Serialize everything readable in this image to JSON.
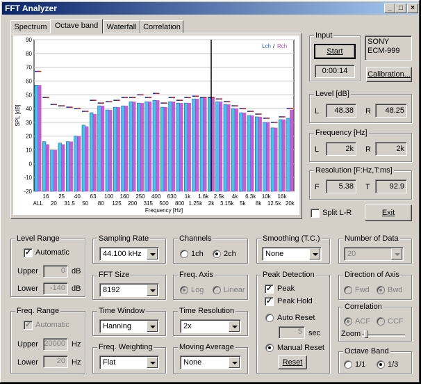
{
  "window": {
    "title": "FFT Analyzer",
    "minimize": "_",
    "maximize": "□",
    "close": "×"
  },
  "tabs": [
    {
      "label": "Spectrum"
    },
    {
      "label": "Octave band"
    },
    {
      "label": "Waterfall"
    },
    {
      "label": "Correlation"
    }
  ],
  "input": {
    "title": "Input",
    "start": "Start",
    "time": "0:00:14",
    "device_line1": "SONY",
    "device_line2": "ECM-999",
    "calibration": "Calibration..."
  },
  "level": {
    "title": "Level [dB]",
    "l_label": "L",
    "l_value": "48.38",
    "r_label": "R",
    "r_value": "48.25"
  },
  "frequency": {
    "title": "Frequency [Hz]",
    "l_label": "L",
    "l_value": "2k",
    "r_label": "R",
    "r_value": "2k"
  },
  "resolution": {
    "title": "Resolution [F:Hz,T:ms]",
    "f_label": "F",
    "f_value": "5.38",
    "t_label": "T",
    "t_value": "92.9"
  },
  "split": {
    "label": "Split L-R"
  },
  "exit": {
    "label": "Exit"
  },
  "level_range": {
    "title": "Level Range",
    "automatic": "Automatic",
    "upper_label": "Upper",
    "upper_value": "0",
    "upper_unit": "dB",
    "lower_label": "Lower",
    "lower_value": "-140",
    "lower_unit": "dB"
  },
  "freq_range": {
    "title": "Freq. Range",
    "automatic": "Automatic",
    "upper_label": "Upper",
    "upper_value": "20000",
    "upper_unit": "Hz",
    "lower_label": "Lower",
    "lower_value": "20",
    "lower_unit": "Hz"
  },
  "sampling_rate": {
    "title": "Sampling Rate",
    "value": "44.100 kHz"
  },
  "fft_size": {
    "title": "FFT Size",
    "value": "8192"
  },
  "time_window": {
    "title": "Time Window",
    "value": "Hanning"
  },
  "freq_weighting": {
    "title": "Freq. Weighting",
    "value": "Flat"
  },
  "channels": {
    "title": "Channels",
    "opt1": "1ch",
    "opt2": "2ch"
  },
  "freq_axis": {
    "title": "Freq. Axis",
    "opt1": "Log",
    "opt2": "Linear"
  },
  "time_resolution": {
    "title": "Time Resolution",
    "value": "2x"
  },
  "moving_average": {
    "title": "Moving Average",
    "value": "None"
  },
  "smoothing": {
    "title": "Smoothing (T.C.)",
    "value": "None"
  },
  "peak_detection": {
    "title": "Peak Detection",
    "peak": "Peak",
    "peak_hold": "Peak Hold",
    "auto_reset": "Auto Reset",
    "sec_value": "5",
    "sec_unit": "sec",
    "manual_reset": "Manual Reset",
    "reset": "Reset"
  },
  "number_of_data": {
    "title": "Number of Data",
    "value": "20"
  },
  "direction_axis": {
    "title": "Direction of Axis",
    "opt1": "Fwd",
    "opt2": "Bwd"
  },
  "correlation": {
    "title": "Correlation",
    "opt1": "ACF",
    "opt2": "CCF",
    "zoom": "Zoom"
  },
  "octave_band": {
    "title": "Octave Band",
    "opt1": "1/1",
    "opt2": "1/3"
  },
  "colors": {
    "lch": "#3ec8f0",
    "rch": "#c040d0",
    "lch_edge": "#1a5aa0",
    "peak_l": "#1030c0",
    "peak_r": "#e01010"
  },
  "chart_data": {
    "type": "bar",
    "ylabel": "SPL [dB]",
    "xlabel": "Frequency [Hz]",
    "ylim": [
      -20,
      90
    ],
    "yticks": [
      -20,
      -10,
      0,
      10,
      20,
      30,
      40,
      50,
      60,
      70,
      80,
      90
    ],
    "legend": {
      "lch": "Lch",
      "rch": "Rch",
      "sep": "/"
    },
    "categories": [
      "ALL",
      "16",
      "20",
      "25",
      "31.5",
      "40",
      "50",
      "63",
      "80",
      "100",
      "125",
      "160",
      "200",
      "250",
      "315",
      "400",
      "500",
      "630",
      "800",
      "1k",
      "1.25k",
      "1.6k",
      "2k",
      "2.5k",
      "3.15k",
      "4k",
      "5k",
      "6.3k",
      "8k",
      "10k",
      "12.5k",
      "16k",
      "20k"
    ],
    "tick_labels_top": [
      "16",
      "25",
      "40",
      "63",
      "100",
      "160",
      "250",
      "400",
      "630",
      "1k",
      "1.6k",
      "2.5k",
      "4k",
      "6.3k",
      "10k",
      "16k"
    ],
    "tick_labels_bottom": [
      "ALL",
      "20",
      "31.5",
      "50",
      "80",
      "125",
      "200",
      "315",
      "500",
      "800",
      "1.25k",
      "2k",
      "3.15k",
      "5k",
      "8k",
      "12.5k",
      "20k"
    ],
    "series": [
      {
        "name": "Lch",
        "values": [
          57,
          16,
          10,
          15,
          16,
          20,
          28,
          37,
          42,
          39,
          41,
          42,
          45,
          44,
          45,
          46,
          41,
          45,
          44,
          44,
          47,
          48,
          48,
          45,
          43,
          40,
          37,
          35,
          34,
          30,
          26,
          32,
          33
        ]
      },
      {
        "name": "Rch",
        "values": [
          57,
          14,
          10,
          14,
          16,
          20,
          27,
          36,
          42,
          39,
          41,
          42,
          45,
          44,
          45,
          46,
          41,
          45,
          44,
          44,
          47,
          48,
          48,
          45,
          43,
          40,
          37,
          35,
          34,
          30,
          26,
          32,
          39
        ]
      }
    ],
    "peak_hold_l": [
      67,
      48,
      43,
      42,
      41,
      40,
      38,
      46,
      44,
      45,
      46,
      48,
      48,
      50,
      48,
      51,
      44,
      48,
      46,
      48,
      49,
      48,
      48,
      47,
      45,
      42,
      40,
      38,
      36,
      33,
      30,
      34,
      40
    ],
    "peak_hold_r": [
      67,
      48,
      43,
      42,
      41,
      40,
      38,
      46,
      44,
      45,
      46,
      48,
      48,
      50,
      48,
      51,
      44,
      48,
      46,
      48,
      49,
      48,
      48,
      47,
      45,
      42,
      40,
      38,
      36,
      33,
      30,
      34,
      40
    ]
  }
}
